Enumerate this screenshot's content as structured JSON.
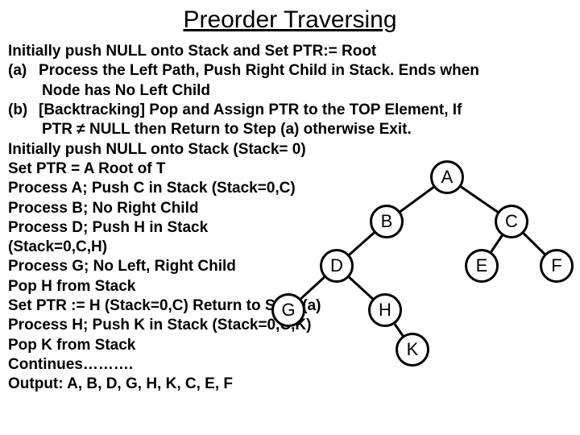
{
  "title": "Preorder Traversing",
  "intro": "Initially push NULL onto Stack and Set PTR:= Root",
  "stepA_label": "(a)",
  "stepA_line1": "Process the Left Path, Push Right Child in Stack. Ends when",
  "stepA_line2": "Node has No Left Child",
  "stepB_label": "(b)",
  "stepB_line1": "[Backtracking] Pop and Assign PTR to the TOP Element, If",
  "stepB_line2": "PTR  ≠ NULL then Return to Step (a) otherwise Exit.",
  "trace": {
    "l1": "Initially push NULL onto Stack (Stack= 0)",
    "l2": "Set PTR = A Root of T",
    "l3": "Process A; Push C in Stack (Stack=0,C)",
    "l4": "Process B; No Right Child",
    "l5": "Process D; Push H in Stack",
    "l6": "(Stack=0,C,H)",
    "l7": "Process G; No Left, Right Child",
    "l8": "Pop H from Stack",
    "l9": "Set PTR := H (Stack=0,C) Return to Step (a)",
    "l10": "Process H; Push K in Stack (Stack=0,C,K)",
    "l11": "Pop K from Stack",
    "l12": "Continues……….",
    "l13": "Output: A, B, D, G, H, K, C, E, F"
  },
  "nodes": {
    "A": "A",
    "B": "B",
    "C": "C",
    "D": "D",
    "E": "E",
    "F": "F",
    "G": "G",
    "H": "H",
    "K": "K"
  }
}
